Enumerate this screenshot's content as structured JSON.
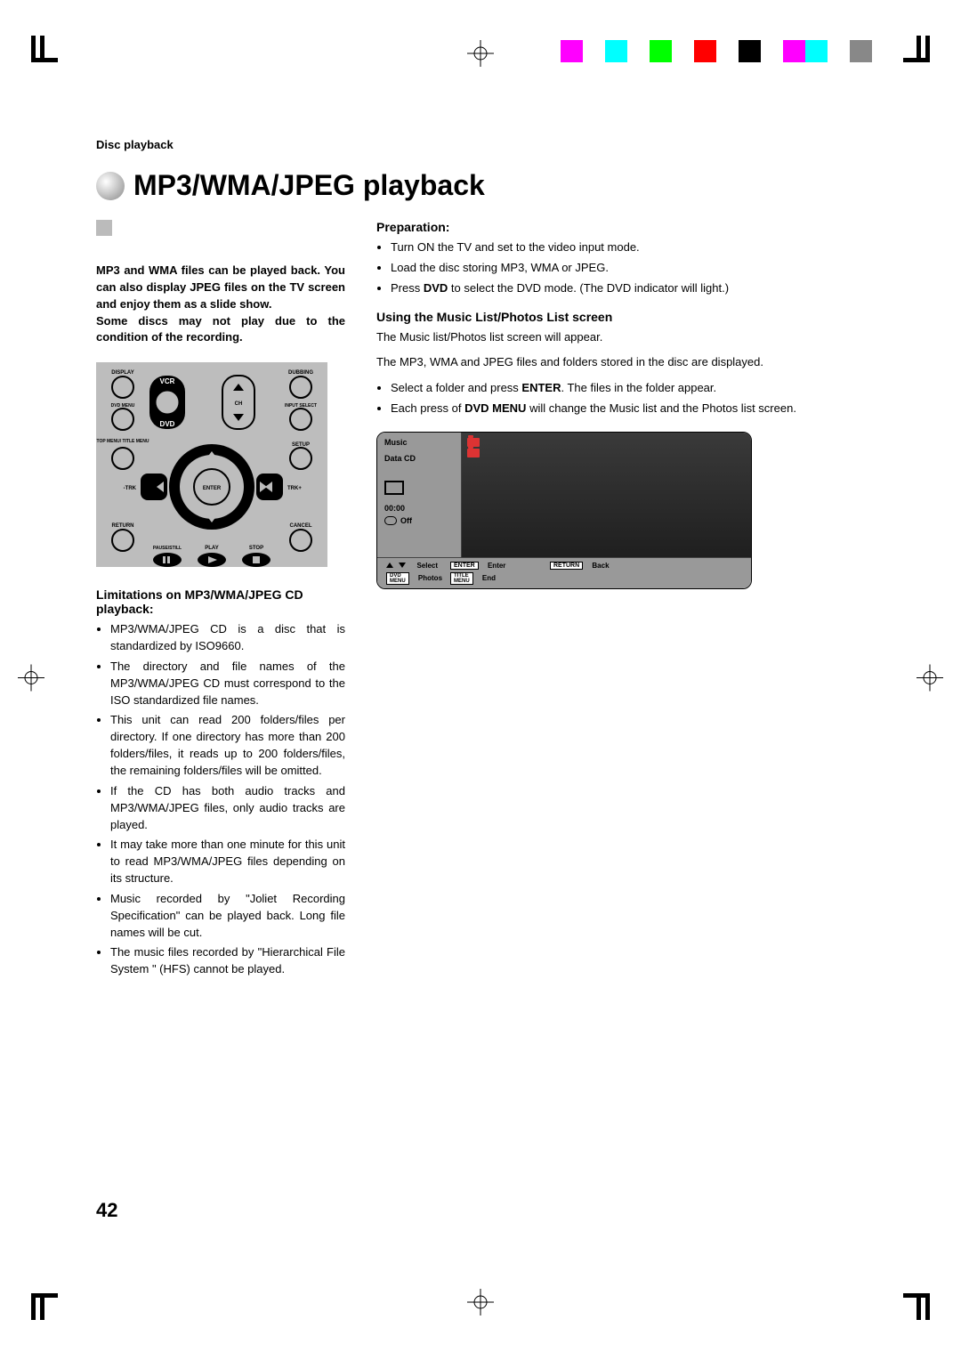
{
  "crumb": "Disc playback",
  "title": "MP3/WMA/JPEG playback",
  "intro": "MP3 and WMA files can be played back. You can also display JPEG files on the TV screen and enjoy them as a slide show.\nSome discs may not play due to the condition of the recording.",
  "remote": {
    "display": "DISPLAY",
    "dubbing": "DUBBING",
    "vcr": "VCR",
    "dvdmenu": "DVD MENU",
    "ch": "CH",
    "inputselect": "INPUT SELECT",
    "dvd": "DVD",
    "topmenu": "TOP MENU/\nTITLE MENU",
    "setup": "SETUP",
    "trkminus": "-TRK",
    "enter": "ENTER",
    "trkplus": "TRK+",
    "return": "RETURN",
    "cancel": "CANCEL",
    "pausestill": "PAUSE/STILL",
    "play": "PLAY",
    "stop": "STOP"
  },
  "limitations": {
    "head": "Limitations on MP3/WMA/JPEG CD playback:",
    "items": [
      "MP3/WMA/JPEG CD is a disc that is standardized by ISO9660.",
      "The directory and file names of the MP3/WMA/JPEG CD must correspond to the ISO standardized file names.",
      "This unit can read 200 folders/files per directory. If one directory has more than 200 folders/files, it reads up to 200 folders/files, the remaining folders/files will be omitted.",
      "If the CD has both audio tracks and MP3/WMA/JPEG files, only audio tracks are played.",
      "It may take more than one minute for this unit to read MP3/WMA/JPEG files depending on its structure.",
      "Music recorded by \"Joliet Recording Specification\" can be played back. Long file names will be cut.",
      "The music files recorded by \"Hierarchical File System \" (HFS) cannot be played."
    ]
  },
  "prep": {
    "head": "Preparation:",
    "items": [
      "Turn ON the TV and set to the video input mode.",
      "Load the disc storing MP3, WMA or JPEG."
    ],
    "press_pre": "Press ",
    "press_bold": "DVD",
    "press_post": " to select the DVD mode. (The DVD indicator will light.)"
  },
  "using": {
    "head": "Using the Music List/Photos List screen",
    "p1": "The Music list/Photos list screen will appear.",
    "p2": "The MP3, WMA and JPEG files and folders stored in the disc are displayed.",
    "b1_pre": "Select a folder and press ",
    "b1_bold": "ENTER",
    "b1_post": ". The files in the folder appear.",
    "b2_pre": "Each press of ",
    "b2_bold": "DVD MENU",
    "b2_post": " will change the Music list and the Photos list screen."
  },
  "osd": {
    "music": "Music",
    "datacd": "Data CD",
    "time": "00:00",
    "off": "Off",
    "select": "Select",
    "enter_cap": "ENTER",
    "enter": "Enter",
    "return_cap": "RETURN",
    "back": "Back",
    "dvdmenu_cap": "DVD\nMENU",
    "photos": "Photos",
    "titlemenu_cap": "TITLE\nMENU",
    "end": "End"
  },
  "page_number": "42"
}
